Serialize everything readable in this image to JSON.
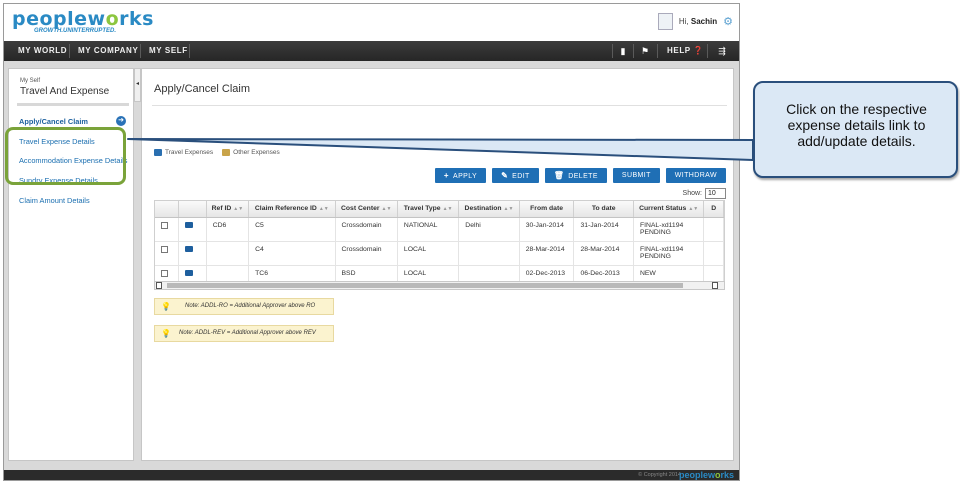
{
  "header": {
    "logo_main_a": "peoplew",
    "logo_main_b": "rks",
    "logo_tagline": "GROWTH.UNINTERRUPTED.",
    "greeting": "Hi,",
    "user_name": "Sachin"
  },
  "nav": {
    "items": [
      "MY WORLD",
      "MY COMPANY",
      "MY SELF"
    ],
    "help_label": "HELP"
  },
  "sidebar": {
    "subtitle": "My Self",
    "title": "Travel And Expense",
    "links": [
      "Apply/Cancel Claim",
      "Travel Expense Details",
      "Accommodation Expense Details",
      "Sundry Expense Details",
      "Claim Amount Details"
    ]
  },
  "main": {
    "title": "Apply/Cancel Claim",
    "tabs": [
      "Travel Expenses",
      "Other Expenses"
    ],
    "buttons": {
      "apply": "APPLY",
      "edit": "EDIT",
      "delete": "DELETE",
      "submit": "SUBMIT",
      "withdraw": "WITHDRAW"
    },
    "show_label": "Show:",
    "show_value": "10",
    "table": {
      "columns": [
        "Ref ID",
        "Claim Reference ID",
        "Cost Center",
        "Travel Type",
        "Destination",
        "From date",
        "To date",
        "Current Status",
        "D"
      ],
      "rows": [
        {
          "ref_id": "CD6",
          "claim_ref": "C5",
          "cost_center": "Crossdomain",
          "travel_type": "NATIONAL",
          "destination": "Delhi",
          "from": "30-Jan-2014",
          "to": "31-Jan-2014",
          "status_1": "FINAL-xd1194",
          "status_2": "PENDING"
        },
        {
          "ref_id": "",
          "claim_ref": "C4",
          "cost_center": "Crossdomain",
          "travel_type": "LOCAL",
          "destination": "",
          "from": "28-Mar-2014",
          "to": "28-Mar-2014",
          "status_1": "FINAL-xd1194",
          "status_2": "PENDING"
        },
        {
          "ref_id": "",
          "claim_ref": "TC6",
          "cost_center": "BSD",
          "travel_type": "LOCAL",
          "destination": "",
          "from": "02-Dec-2013",
          "to": "06-Dec-2013",
          "status_1": "NEW",
          "status_2": ""
        }
      ]
    },
    "notes": [
      "Note: ADDL-RO = Additional Approver above RO",
      "Note: ADDL-REV = Additional Approver above REV"
    ]
  },
  "footer": {
    "copyright": "© Copyright 2014",
    "logo_a": "peoplew",
    "logo_b": "rks"
  },
  "callout": {
    "text": "Click on the respective expense details link to add/update details."
  },
  "colors": {
    "brand_blue": "#2a8ac4",
    "brand_green": "#8cc63f",
    "button_blue": "#1f6fb5",
    "highlight_green": "#7aa33a"
  }
}
